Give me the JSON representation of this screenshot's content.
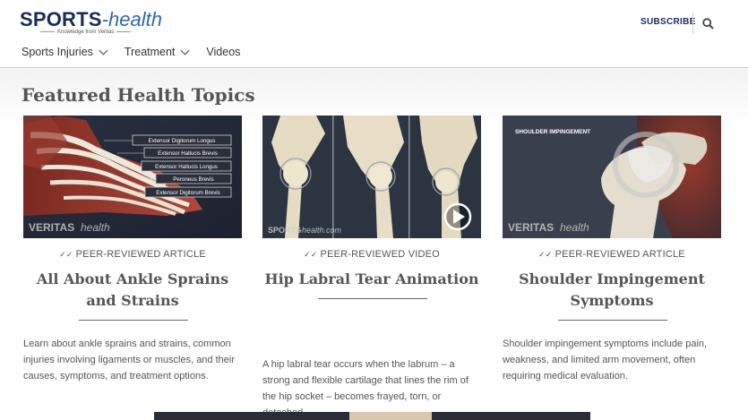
{
  "header": {
    "logo_bold": "SPORTS",
    "logo_light": "-health",
    "logo_tagline": "Knowledge from Veritas",
    "subscribe_label": "SUBSCRIBE",
    "nav": [
      {
        "label": "Sports Injuries",
        "has_dropdown": true
      },
      {
        "label": "Treatment",
        "has_dropdown": true
      },
      {
        "label": "Videos",
        "has_dropdown": false
      }
    ],
    "search_icon": "search-icon"
  },
  "section": {
    "title": "Featured Health Topics"
  },
  "cards": [
    {
      "kind": "PEER-REVIEWED ARTICLE",
      "title": "All About Ankle Sprains and Strains",
      "description": "Learn about ankle sprains and strains, common injuries involving ligaments or muscles, and their causes, symptoms, and treatment options.",
      "image_labels": [
        "Extensor Digitorum Longus",
        "Extensor Hallucis Brevis",
        "Extensor Hallucis Longus",
        "Peroneus Brevis",
        "Extensor Digitorum Brevis"
      ],
      "watermark_bold": "VERITAS",
      "watermark_light": "health"
    },
    {
      "kind": "PEER-REVIEWED VIDEO",
      "title": "Hip Labral Tear Animation",
      "description": "A hip labral tear occurs when the labrum – a strong and flexible cartilage that lines the rim of the hip socket – becomes frayed, torn, or detached.",
      "watermark_bold": "SPORTS",
      "watermark_light": "-health.com"
    },
    {
      "kind": "PEER-REVIEWED ARTICLE",
      "title": "Shoulder Impingement Symptoms",
      "description": "Shoulder impingement symptoms include pain, weakness, and limited arm movement, often requiring medical evaluation.",
      "image_label": "SHOULDER IMPINGEMENT",
      "watermark_bold": "VERITAS",
      "watermark_light": "health"
    }
  ],
  "colors": {
    "brand_navy": "#1b2a5c",
    "brand_blue": "#2e6aa8",
    "text_gray": "#555555"
  }
}
